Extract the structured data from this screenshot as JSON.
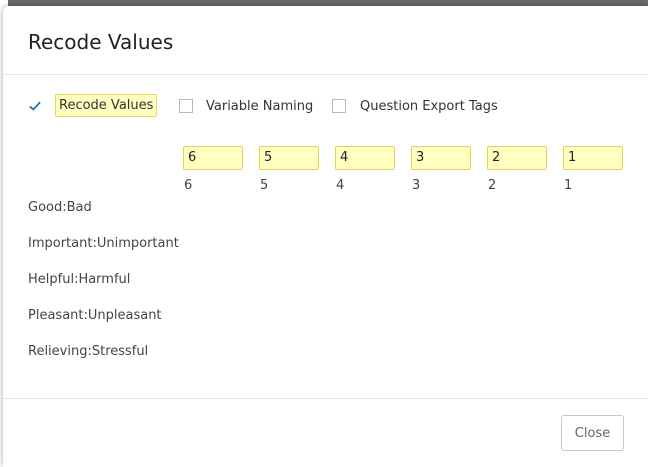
{
  "dialog": {
    "title": "Recode Values",
    "options": [
      {
        "label": "Recode Values",
        "checked": true
      },
      {
        "label": "Variable Naming",
        "checked": false
      },
      {
        "label": "Question Export Tags",
        "checked": false
      }
    ],
    "recode_inputs": [
      "6",
      "5",
      "4",
      "3",
      "2",
      "1"
    ],
    "original_values": [
      "6",
      "5",
      "4",
      "3",
      "2",
      "1"
    ],
    "rows": [
      "Good:Bad",
      "Important:Unimportant",
      "Helpful:Harmful",
      "Pleasant:Unpleasant",
      "Relieving:Stressful"
    ],
    "close_label": "Close"
  },
  "colors": {
    "accent": "#1a73b5",
    "highlight_bg": "#ffffc0",
    "highlight_border": "#e6cf57"
  }
}
